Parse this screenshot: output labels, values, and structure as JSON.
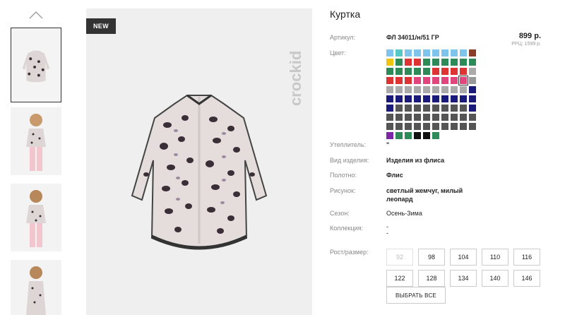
{
  "product": {
    "title": "Куртка",
    "article_label": "Артикул:",
    "article_value": "ФЛ 34011/н/51 ГР",
    "price": "899 р.",
    "rrp": "РРЦ: 1599 р.",
    "color_label": "Цвет:",
    "badge": "NEW",
    "brand_text": "crockid"
  },
  "colors": [
    "#7fc4ec",
    "#56c9c5",
    "#7fc4ec",
    "#7fc4ec",
    "#7fc4ec",
    "#7fc4ec",
    "#7fc4ec",
    "#7fc4ec",
    "#7fc4ec",
    "#8a3d2b",
    "#f1c40f",
    "#2e8b57",
    "#d33",
    "#d33",
    "#2e8b57",
    "#2e8b57",
    "#2e8b57",
    "#2e8b57",
    "#2e8b57",
    "#2e8b57",
    "#2e8b57",
    "#2e8b57",
    "#2e8b57",
    "#2e8b57",
    "#2e8b57",
    "#d33",
    "#d33",
    "#d33",
    "#d33",
    "#aaa",
    "#d33",
    "#d33",
    "#d33",
    "#e0457b",
    "#e0457b",
    "#e0457b",
    "#e0457b",
    "#e0457b",
    "#e0457b",
    "#999",
    "#aaa",
    "#aaa",
    "#aaa",
    "#aaa",
    "#aaa",
    "#aaa",
    "#aaa",
    "#aaa",
    "#aaa",
    "#1a1a7a",
    "#1a1a7a",
    "#1a1a7a",
    "#1a1a7a",
    "#1a1a7a",
    "#1a1a7a",
    "#1a1a7a",
    "#1a1a7a",
    "#1a1a7a",
    "#1a1a7a",
    "#1a1a7a",
    "#1a1a7a",
    "#555",
    "#555",
    "#555",
    "#555",
    "#555",
    "#555",
    "#555",
    "#555",
    "#1a1a7a",
    "#555",
    "#555",
    "#555",
    "#555",
    "#555",
    "#555",
    "#555",
    "#555",
    "#555",
    "#555",
    "#555",
    "#555",
    "#555",
    "#555",
    "#555",
    "#555",
    "#555",
    "#555",
    "#555",
    "#555",
    "#7b28a8",
    "#2e8b57",
    "#2e8b57",
    "#111",
    "#111",
    "#2e8b57"
  ],
  "selected_color_index": 38,
  "specs": {
    "insulation_label": "Утеплитель:",
    "insulation_value": "\"",
    "type_label": "Вид изделия:",
    "type_value": "Изделия из флиса",
    "fabric_label": "Полотно:",
    "fabric_value": "Флис",
    "pattern_label": "Рисунок:",
    "pattern_value_1": "светлый жемчуг, милый",
    "pattern_value_2": "леопард",
    "season_label": "Сезон:",
    "season_value": "Осень-Зима",
    "collection_label": "Коллекция:",
    "collection_value_1": "-",
    "collection_value_2": "-"
  },
  "sizes": {
    "label": "Рост/размер:",
    "items": [
      "92",
      "98",
      "104",
      "110",
      "116",
      "122",
      "128",
      "134",
      "140",
      "146"
    ],
    "disabled": [
      "92"
    ],
    "select_all": "ВЫБРАТЬ ВСЕ"
  }
}
